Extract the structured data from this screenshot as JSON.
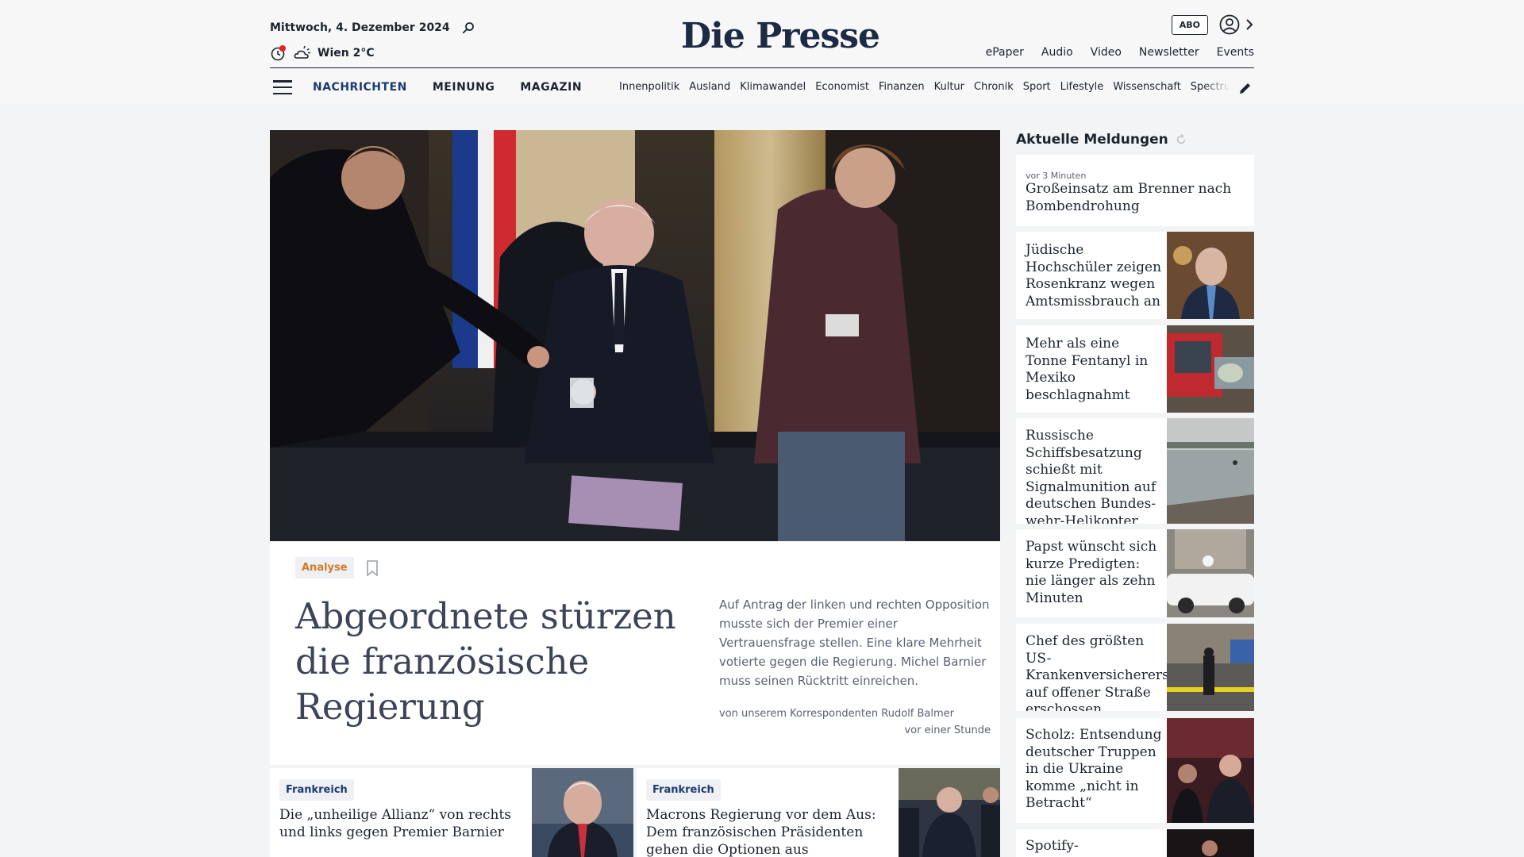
{
  "header": {
    "date": "Mittwoch, 4. Dezember 2024",
    "weather": "Wien 2°C",
    "logo": "Die Presse",
    "abo_label": "ABO",
    "service_links": [
      "ePaper",
      "Audio",
      "Video",
      "Newsletter",
      "Events"
    ]
  },
  "nav": {
    "main": [
      "NACHRICHTEN",
      "MEINUNG",
      "MAGAZIN"
    ],
    "sub": [
      "Innenpolitik",
      "Ausland",
      "Klimawandel",
      "Economist",
      "Finanzen",
      "Kultur",
      "Chronik",
      "Sport",
      "Lifestyle",
      "Wissenschaft",
      "Spectrum"
    ]
  },
  "lead": {
    "kicker": "Analyse",
    "headline": "Abgeordnete stürzen die französische Regierung",
    "teaser": "Auf Antrag der linken und rechten Opposition musste sich der Premier einer Vertrauensfrage stellen. Eine klare Mehrheit votierte gegen die Regierung. Michel Barnier muss seinen Rücktritt einreichen.",
    "byline": "von unserem Korrespondenten Rudolf Balmer",
    "time": "vor einer Stunde"
  },
  "subcards": [
    {
      "tag": "Frankreich",
      "title": "Die „unheilige Allianz“ von rechts und links gegen Premier Barnier"
    },
    {
      "tag": "Frankreich",
      "title": "Macrons Regierung vor dem Aus: Dem französischen Präsidenten gehen die Optionen aus"
    }
  ],
  "sidebar": {
    "title": "Aktuelle Meldungen",
    "items": [
      {
        "time": "vor 3 Minuten",
        "title": "Großeinsatz am Brenner nach Bombendrohung"
      },
      {
        "title": "Jüdische Hochschüler zeigen Rosenkranz wegen Amtsmissbrauch an"
      },
      {
        "title": "Mehr als eine Tonne Fentanyl in Mexiko beschlagnahmt"
      },
      {
        "title": "Russische Schiffsbe­satzung schießt mit Signalmunition auf deutschen Bundes­wehr-Helikopter"
      },
      {
        "title": "Papst wünscht sich kurze Predigten: nie länger als zehn Minuten"
      },
      {
        "title": "Chef des größten US-Krankenversicherers auf offener Straße erschossen"
      },
      {
        "title": "Scholz: Entsendung deutscher Truppen in die Ukraine komme „nicht in Betracht“"
      },
      {
        "title": "Spotify-Jahrescharts:"
      }
    ]
  },
  "colors": {
    "accent": "#1c3c6e",
    "kicker_orange": "#d17a28",
    "headline_gray": "#3b4458",
    "background": "#f3f4f6"
  },
  "icons": [
    "search-icon",
    "history-icon",
    "weather-cloud-sun-icon",
    "user-icon",
    "chevron-right-icon",
    "menu-icon",
    "pencil-icon",
    "bookmark-icon",
    "refresh-icon"
  ]
}
